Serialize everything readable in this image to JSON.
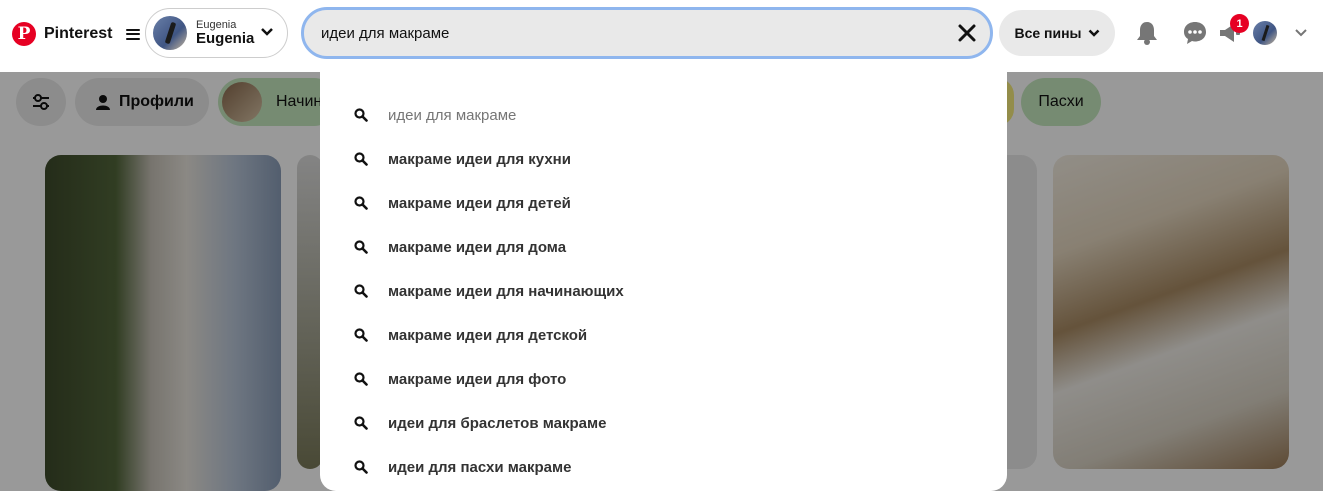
{
  "header": {
    "brand": "Pinterest",
    "account": {
      "small_name": "Eugenia",
      "name": "Eugenia"
    },
    "search": {
      "value": "идеи для макраме",
      "placeholder": ""
    },
    "filter_label": "Все пины",
    "notification_count": "1"
  },
  "chips": [
    {
      "label": ""
    },
    {
      "label": "Профили"
    },
    {
      "label": "Начин"
    },
    {
      "label": "Пасхи"
    }
  ],
  "suggestions": [
    "идеи для макраме",
    "макраме идеи для кухни",
    "макраме идеи для детей",
    "макраме идеи для дома",
    "макраме идеи для начинающих",
    "макраме идеи для детской",
    "макраме идеи для фото",
    "идеи для браслетов макраме",
    "идеи для пасхи макраме"
  ],
  "icons": {
    "logo": "pinterest-logo",
    "menu": "hamburger-icon",
    "chevron": "chevron-down-icon",
    "clear": "close-icon",
    "bell": "bell-icon",
    "chat": "chat-icon",
    "megaphone": "megaphone-icon",
    "search": "search-icon",
    "filters": "sliders-icon",
    "person": "person-icon"
  },
  "colors": {
    "brand": "#e60023",
    "search_border": "#8fb6ee",
    "pill_bg": "#e9e9e9",
    "chip_green": "#c5e8bf"
  }
}
